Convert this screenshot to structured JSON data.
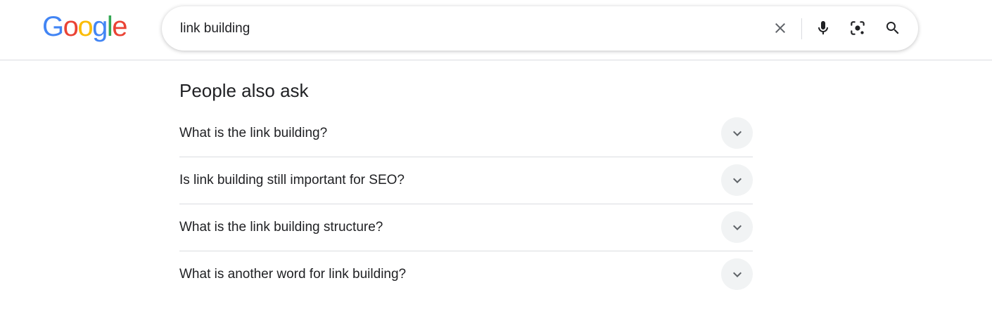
{
  "logo": {
    "letters": [
      "G",
      "o",
      "o",
      "g",
      "l",
      "e"
    ],
    "colors": [
      "#4285F4",
      "#EA4335",
      "#FBBC05",
      "#4285F4",
      "#34A853",
      "#EA4335"
    ]
  },
  "search": {
    "value": "link building",
    "icons": [
      "close-icon",
      "microphone-icon",
      "camera-lens-icon",
      "search-icon"
    ]
  },
  "paa": {
    "title": "People also ask",
    "questions": [
      "What is the link building?",
      "Is link building still important for SEO?",
      "What is the link building structure?",
      "What is another word for link building?"
    ],
    "expand_icon": "chevron-down-icon"
  },
  "colors": {
    "text": "#202124",
    "icon": "#5f6368",
    "divider": "#dadce0",
    "chevron_bg": "#f1f3f4"
  }
}
